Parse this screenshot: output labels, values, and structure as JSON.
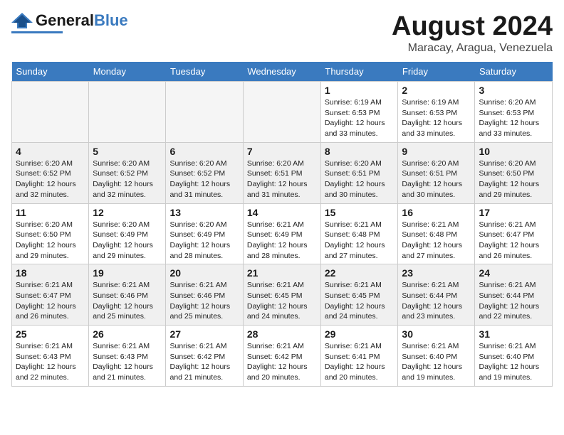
{
  "header": {
    "logo_general": "General",
    "logo_blue": "Blue",
    "month_year": "August 2024",
    "location": "Maracay, Aragua, Venezuela"
  },
  "days_of_week": [
    "Sunday",
    "Monday",
    "Tuesday",
    "Wednesday",
    "Thursday",
    "Friday",
    "Saturday"
  ],
  "weeks": [
    {
      "days": [
        {
          "number": "",
          "info": ""
        },
        {
          "number": "",
          "info": ""
        },
        {
          "number": "",
          "info": ""
        },
        {
          "number": "",
          "info": ""
        },
        {
          "number": "1",
          "info": "Sunrise: 6:19 AM\nSunset: 6:53 PM\nDaylight: 12 hours\nand 33 minutes."
        },
        {
          "number": "2",
          "info": "Sunrise: 6:19 AM\nSunset: 6:53 PM\nDaylight: 12 hours\nand 33 minutes."
        },
        {
          "number": "3",
          "info": "Sunrise: 6:20 AM\nSunset: 6:53 PM\nDaylight: 12 hours\nand 33 minutes."
        }
      ]
    },
    {
      "days": [
        {
          "number": "4",
          "info": "Sunrise: 6:20 AM\nSunset: 6:52 PM\nDaylight: 12 hours\nand 32 minutes."
        },
        {
          "number": "5",
          "info": "Sunrise: 6:20 AM\nSunset: 6:52 PM\nDaylight: 12 hours\nand 32 minutes."
        },
        {
          "number": "6",
          "info": "Sunrise: 6:20 AM\nSunset: 6:52 PM\nDaylight: 12 hours\nand 31 minutes."
        },
        {
          "number": "7",
          "info": "Sunrise: 6:20 AM\nSunset: 6:51 PM\nDaylight: 12 hours\nand 31 minutes."
        },
        {
          "number": "8",
          "info": "Sunrise: 6:20 AM\nSunset: 6:51 PM\nDaylight: 12 hours\nand 30 minutes."
        },
        {
          "number": "9",
          "info": "Sunrise: 6:20 AM\nSunset: 6:51 PM\nDaylight: 12 hours\nand 30 minutes."
        },
        {
          "number": "10",
          "info": "Sunrise: 6:20 AM\nSunset: 6:50 PM\nDaylight: 12 hours\nand 29 minutes."
        }
      ]
    },
    {
      "days": [
        {
          "number": "11",
          "info": "Sunrise: 6:20 AM\nSunset: 6:50 PM\nDaylight: 12 hours\nand 29 minutes."
        },
        {
          "number": "12",
          "info": "Sunrise: 6:20 AM\nSunset: 6:49 PM\nDaylight: 12 hours\nand 29 minutes."
        },
        {
          "number": "13",
          "info": "Sunrise: 6:20 AM\nSunset: 6:49 PM\nDaylight: 12 hours\nand 28 minutes."
        },
        {
          "number": "14",
          "info": "Sunrise: 6:21 AM\nSunset: 6:49 PM\nDaylight: 12 hours\nand 28 minutes."
        },
        {
          "number": "15",
          "info": "Sunrise: 6:21 AM\nSunset: 6:48 PM\nDaylight: 12 hours\nand 27 minutes."
        },
        {
          "number": "16",
          "info": "Sunrise: 6:21 AM\nSunset: 6:48 PM\nDaylight: 12 hours\nand 27 minutes."
        },
        {
          "number": "17",
          "info": "Sunrise: 6:21 AM\nSunset: 6:47 PM\nDaylight: 12 hours\nand 26 minutes."
        }
      ]
    },
    {
      "days": [
        {
          "number": "18",
          "info": "Sunrise: 6:21 AM\nSunset: 6:47 PM\nDaylight: 12 hours\nand 26 minutes."
        },
        {
          "number": "19",
          "info": "Sunrise: 6:21 AM\nSunset: 6:46 PM\nDaylight: 12 hours\nand 25 minutes."
        },
        {
          "number": "20",
          "info": "Sunrise: 6:21 AM\nSunset: 6:46 PM\nDaylight: 12 hours\nand 25 minutes."
        },
        {
          "number": "21",
          "info": "Sunrise: 6:21 AM\nSunset: 6:45 PM\nDaylight: 12 hours\nand 24 minutes."
        },
        {
          "number": "22",
          "info": "Sunrise: 6:21 AM\nSunset: 6:45 PM\nDaylight: 12 hours\nand 24 minutes."
        },
        {
          "number": "23",
          "info": "Sunrise: 6:21 AM\nSunset: 6:44 PM\nDaylight: 12 hours\nand 23 minutes."
        },
        {
          "number": "24",
          "info": "Sunrise: 6:21 AM\nSunset: 6:44 PM\nDaylight: 12 hours\nand 22 minutes."
        }
      ]
    },
    {
      "days": [
        {
          "number": "25",
          "info": "Sunrise: 6:21 AM\nSunset: 6:43 PM\nDaylight: 12 hours\nand 22 minutes."
        },
        {
          "number": "26",
          "info": "Sunrise: 6:21 AM\nSunset: 6:43 PM\nDaylight: 12 hours\nand 21 minutes."
        },
        {
          "number": "27",
          "info": "Sunrise: 6:21 AM\nSunset: 6:42 PM\nDaylight: 12 hours\nand 21 minutes."
        },
        {
          "number": "28",
          "info": "Sunrise: 6:21 AM\nSunset: 6:42 PM\nDaylight: 12 hours\nand 20 minutes."
        },
        {
          "number": "29",
          "info": "Sunrise: 6:21 AM\nSunset: 6:41 PM\nDaylight: 12 hours\nand 20 minutes."
        },
        {
          "number": "30",
          "info": "Sunrise: 6:21 AM\nSunset: 6:40 PM\nDaylight: 12 hours\nand 19 minutes."
        },
        {
          "number": "31",
          "info": "Sunrise: 6:21 AM\nSunset: 6:40 PM\nDaylight: 12 hours\nand 19 minutes."
        }
      ]
    }
  ]
}
